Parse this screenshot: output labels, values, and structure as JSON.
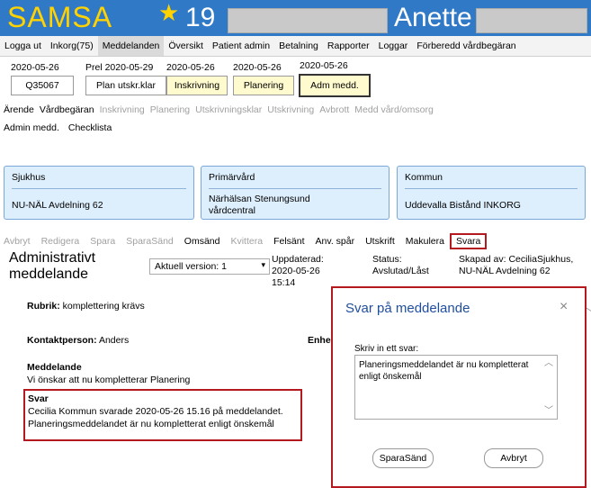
{
  "header": {
    "brand": "SAMSA",
    "star_icon": "★",
    "patient_id": "19",
    "patient_name": "Anette"
  },
  "menu": [
    "Logga ut",
    "Inkorg(75)",
    "Meddelanden",
    "Översikt",
    "Patient admin",
    "Betalning",
    "Rapporter",
    "Loggar",
    "Förberedd vårdbegäran"
  ],
  "dates": {
    "d1": "2020-05-26",
    "prel": "Prel 2020-05-29",
    "d2": "2020-05-26",
    "d3": "2020-05-26",
    "d4": "2020-05-26",
    "case_id": "Q35067",
    "plan": "Plan utskr.klar",
    "inskrivning": "Inskrivning",
    "planering": "Planering",
    "adm": "Adm medd."
  },
  "actions_row1": [
    {
      "label": "Ärende",
      "enabled": true
    },
    {
      "label": "Vårdbegäran",
      "enabled": true
    },
    {
      "label": "Inskrivning",
      "enabled": false
    },
    {
      "label": "Planering",
      "enabled": false
    },
    {
      "label": "Utskrivningsklar",
      "enabled": false
    },
    {
      "label": "Utskrivning",
      "enabled": false
    },
    {
      "label": "Avbrott",
      "enabled": false
    },
    {
      "label": "Medd vård/omsorg",
      "enabled": false
    }
  ],
  "actions_row2": [
    "Admin medd.",
    "Checklista"
  ],
  "cards": {
    "sjukhus": {
      "title": "Sjukhus",
      "value": "NU-NÄL Avdelning 62"
    },
    "primarvard": {
      "title": "Primärvård",
      "value": "Närhälsan Stenungsund vårdcentral"
    },
    "kommun": {
      "title": "Kommun",
      "value": "Uddevalla Bistånd INKORG"
    }
  },
  "toolbar": [
    {
      "label": "Avbryt",
      "enabled": false
    },
    {
      "label": "Redigera",
      "enabled": false
    },
    {
      "label": "Spara",
      "enabled": false
    },
    {
      "label": "SparaSänd",
      "enabled": false
    },
    {
      "label": "Omsänd",
      "enabled": true
    },
    {
      "label": "Kvittera",
      "enabled": false
    },
    {
      "label": "Felsänt",
      "enabled": true
    },
    {
      "label": "Anv. spår",
      "enabled": true
    },
    {
      "label": "Utskrift",
      "enabled": true
    },
    {
      "label": "Makulera",
      "enabled": true
    },
    {
      "label": "Svara",
      "enabled": true
    }
  ],
  "message": {
    "heading": "Administrativt meddelande",
    "version": "Aktuell version: 1",
    "updated": "Uppdaterad: 2020-05-26 15:14",
    "status": "Status: Avslutad/Låst",
    "created": "Skapad av: CeciliaSjukhus, NU-NÄL Avdelning 62",
    "rubrik_label": "Rubrik:",
    "rubrik_value": "komplettering krävs",
    "kontakt_label": "Kontaktperson:",
    "kontakt_value": "Anders",
    "enhet_label": "Enhe",
    "meddelande_label": "Meddelande",
    "meddelande_text": "Vi önskar att nu kompletterar Planering",
    "svar_label": "Svar",
    "svar_line1": "Cecilia Kommun svarade 2020-05-26 15.16 på meddelandet.",
    "svar_line2": "Planeringsmeddelandet är nu kompletterat enligt önskemål"
  },
  "dialog": {
    "title": "Svar på meddelande",
    "close_icon": "×",
    "input_label": "Skriv in ett svar:",
    "input_value": "Planeringsmeddelandet är nu kompletterat enligt önskemål",
    "save_send": "SparaSänd",
    "cancel": "Avbryt"
  },
  "colors": {
    "header_bg": "#2f79c7",
    "brand": "#ffd200",
    "highlight_red": "#b3191f",
    "tab_yellow": "#fffbcf",
    "card_bg": "#ddeefc"
  }
}
